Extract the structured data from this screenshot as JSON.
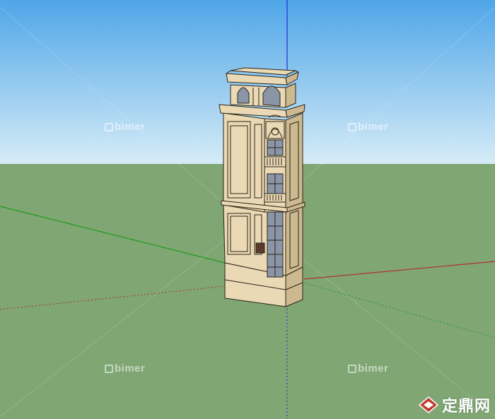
{
  "scene": {
    "sky_top_color": "#4fa6e8",
    "sky_bottom_color": "#d6ecf7",
    "ground_color": "#7fa673",
    "model_fill_color": "#ead9b4",
    "model_shadow_color": "#cdb98f",
    "window_glass_color": "#8a96a8",
    "axis_red_color": "#b03030",
    "axis_green_color": "#209a20",
    "axis_blue_color": "#2030d0"
  },
  "watermarks": {
    "top_left": "bimer",
    "top_right": "bimer",
    "bottom_left": "bimer",
    "bottom_right": "bimer"
  },
  "logo": {
    "text": "定鼎网",
    "icon": "diamond-logo-icon",
    "brand_color": "#c0392b"
  }
}
